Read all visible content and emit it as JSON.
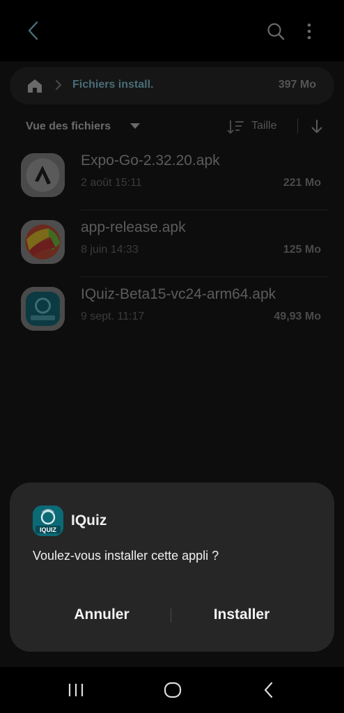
{
  "topbar": {
    "back_icon": "chevron-left-icon",
    "search_icon": "search-icon",
    "more_icon": "more-vertical-icon"
  },
  "breadcrumb": {
    "home_icon": "home-icon",
    "folder": "Fichiers install.",
    "total_size": "397 Mo"
  },
  "view": {
    "label": "Vue des fichiers",
    "sort_label": "Taille"
  },
  "files": [
    {
      "name": "Expo-Go-2.32.20.apk",
      "date": "2 août 15:11",
      "size": "221 Mo"
    },
    {
      "name": "app-release.apk",
      "date": "8 juin 14:33",
      "size": "125 Mo"
    },
    {
      "name": "IQuiz-Beta15-vc24-arm64.apk",
      "date": "9 sept. 11:17",
      "size": "49,93 Mo"
    }
  ],
  "dialog": {
    "app_name": "IQuiz",
    "logo_text": "IQUIZ",
    "question": "Voulez-vous installer cette appli ?",
    "cancel": "Annuler",
    "install": "Installer"
  },
  "colors": {
    "accent_teal": "#0c5e6a",
    "dialog_bg": "#262626",
    "folder_title": "#4a6d78"
  }
}
